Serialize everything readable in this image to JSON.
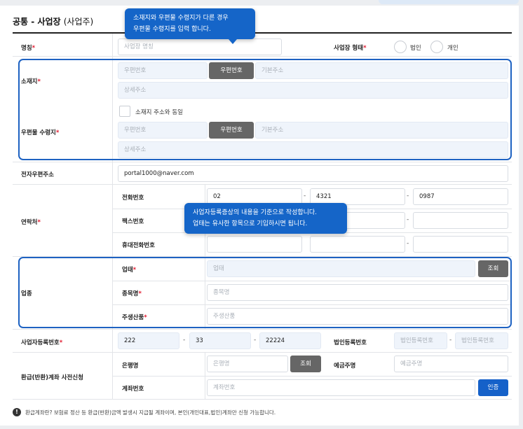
{
  "title": {
    "main": "공통 - 사업장",
    "sub": "(사업주)"
  },
  "labels": {
    "name": "명칭",
    "biz_type": "사업장 형태",
    "location": "소재지",
    "mail_addr": "우편물 수령지",
    "email": "전자우편주소",
    "contact": "연락처",
    "phone": "전화번호",
    "fax": "팩스번호",
    "mobile": "휴대전화번호",
    "industry": "업종",
    "business_type": "업태",
    "item_name": "종목명",
    "main_product": "주생산품",
    "biz_reg_no": "사업자등록번호",
    "corp_reg_no": "법인등록번호",
    "refund": "환급(반환)계좌 사전신청",
    "bank": "은행명",
    "holder": "예금주명",
    "account": "계좌번호",
    "required_mark": "*"
  },
  "radios": {
    "corporate": "법인",
    "individual": "개인"
  },
  "placeholders": {
    "name": "사업장 명칭",
    "zipcode": "우편번호",
    "base_addr": "기본주소",
    "detail_addr": "상세주소",
    "business_type": "업태",
    "item_name": "종목명",
    "main_product": "주생산품",
    "corp_reg_no": "법인등록번호",
    "bank": "은행명",
    "holder": "예금주명",
    "account": "계좌번호"
  },
  "buttons": {
    "zipcode": "우편번호",
    "search": "조회",
    "verify": "인증"
  },
  "checkbox": {
    "same_as_location": "소재지 주소와 동일"
  },
  "values": {
    "email": "portal1000@naver.com",
    "phone": [
      "02",
      "4321",
      "0987"
    ],
    "biz_reg_no": [
      "222",
      "33",
      "22224"
    ]
  },
  "separators": {
    "dash": "-"
  },
  "tooltips": {
    "address": [
      "소재지와 우편물 수령지가 다른 경우",
      "우편물 수령지를 입력 합니다."
    ],
    "industry": [
      "사업자등록증상의 내용을 기준으로 작성합니다.",
      "업태는 유사한 항목으로 기입하시면 됩니다."
    ]
  },
  "footnote": "환급계좌란? 보험료 정산 등 환급(반환)금액 발생시 지급될 계좌이며, 본인(개인대표,법인)계좌만 신청 가능합니다.",
  "icons": {
    "info": "info-icon"
  },
  "colors": {
    "primary": "#1561c9",
    "required": "#e0192e",
    "dark_button": "#666666"
  }
}
